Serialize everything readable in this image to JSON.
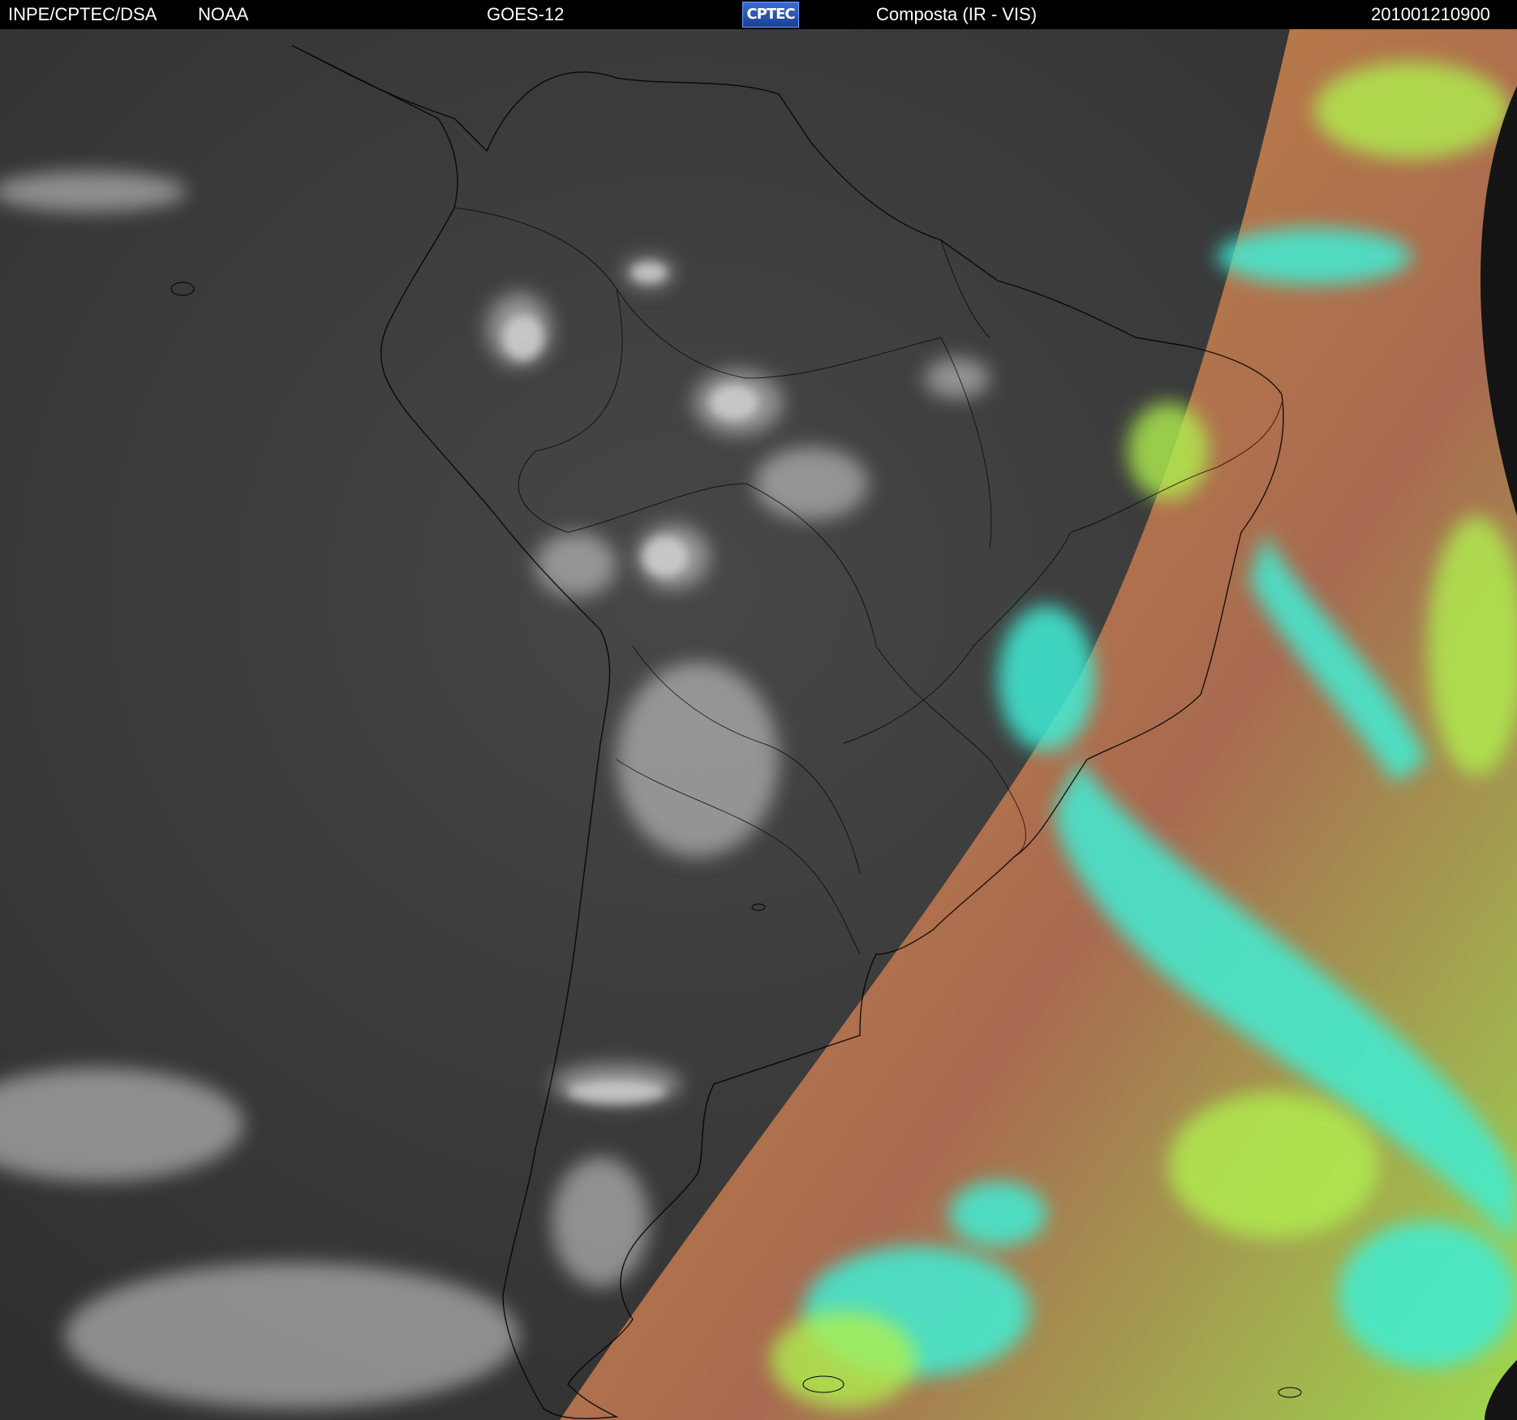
{
  "header": {
    "institution": "INPE/CPTEC/DSA",
    "agency": "NOAA",
    "satellite": "GOES-12",
    "logo_text": "CPTEC",
    "product": "Composta (IR - VIS)",
    "timestamp": "201001210900"
  },
  "imagery": {
    "description_icon": "satellite-composite-image",
    "colors": {
      "night_side": "#3a3a3a",
      "night_clouds": "#cfcfcf",
      "day_ground": "#b06a4a",
      "day_vegetation": "#a8f050",
      "day_clouds": "#3ff0d8",
      "coastline": "#000000"
    }
  }
}
